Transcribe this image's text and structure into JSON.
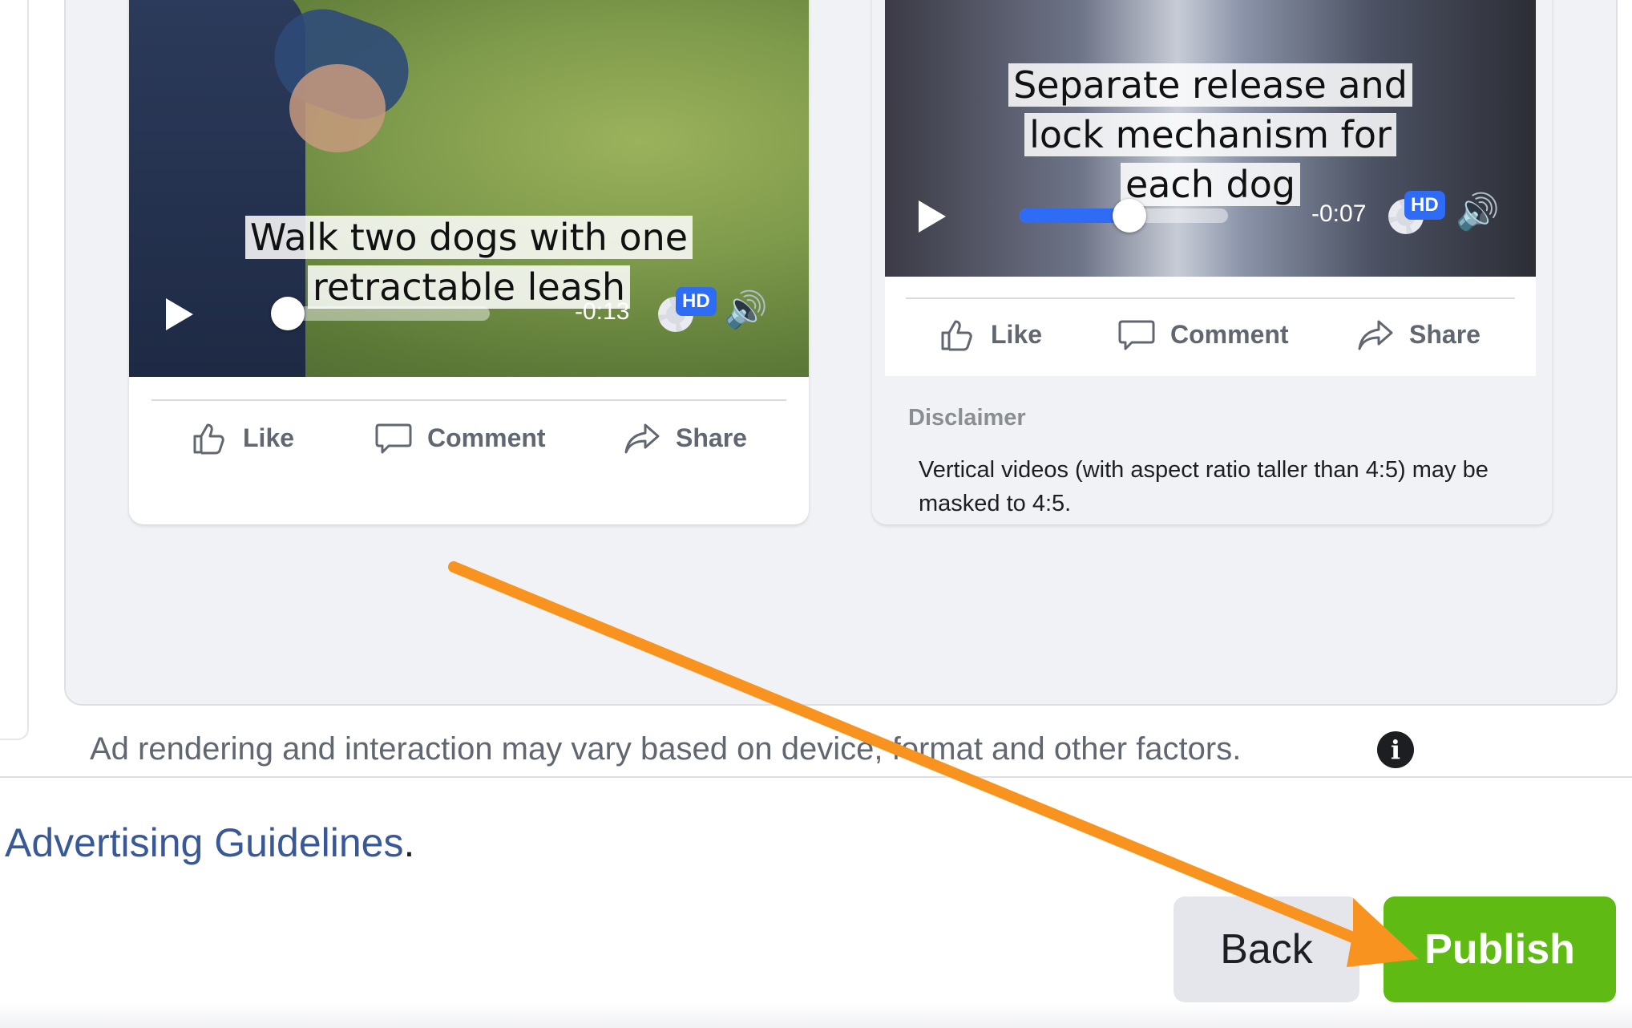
{
  "left_card": {
    "caption_line1": "Walk two dogs with one",
    "caption_line2": "retractable leash",
    "time": "-0:13",
    "progress": 0.0,
    "hd": "HD"
  },
  "right_card": {
    "caption_line1": "Separate release and",
    "caption_line2": "lock mechanism for",
    "caption_line3": "each dog",
    "time": "-0:07",
    "progress": 0.5,
    "hd": "HD"
  },
  "actions": {
    "like": "Like",
    "comment": "Comment",
    "share": "Share"
  },
  "disclaimer": {
    "title": "Disclaimer",
    "text": "Vertical videos (with aspect ratio taller than 4:5) may be masked to 4:5."
  },
  "render_note": "Ad rendering and interaction may vary based on device, format and other factors.",
  "guidelines": {
    "link": "Advertising Guidelines",
    "suffix": "."
  },
  "buttons": {
    "back": "Back",
    "publish": "Publish"
  },
  "colors": {
    "publish_bg": "#5fbb14",
    "link": "#385898",
    "arrow": "#f7931e",
    "hd_badge": "#2f6cf5"
  }
}
